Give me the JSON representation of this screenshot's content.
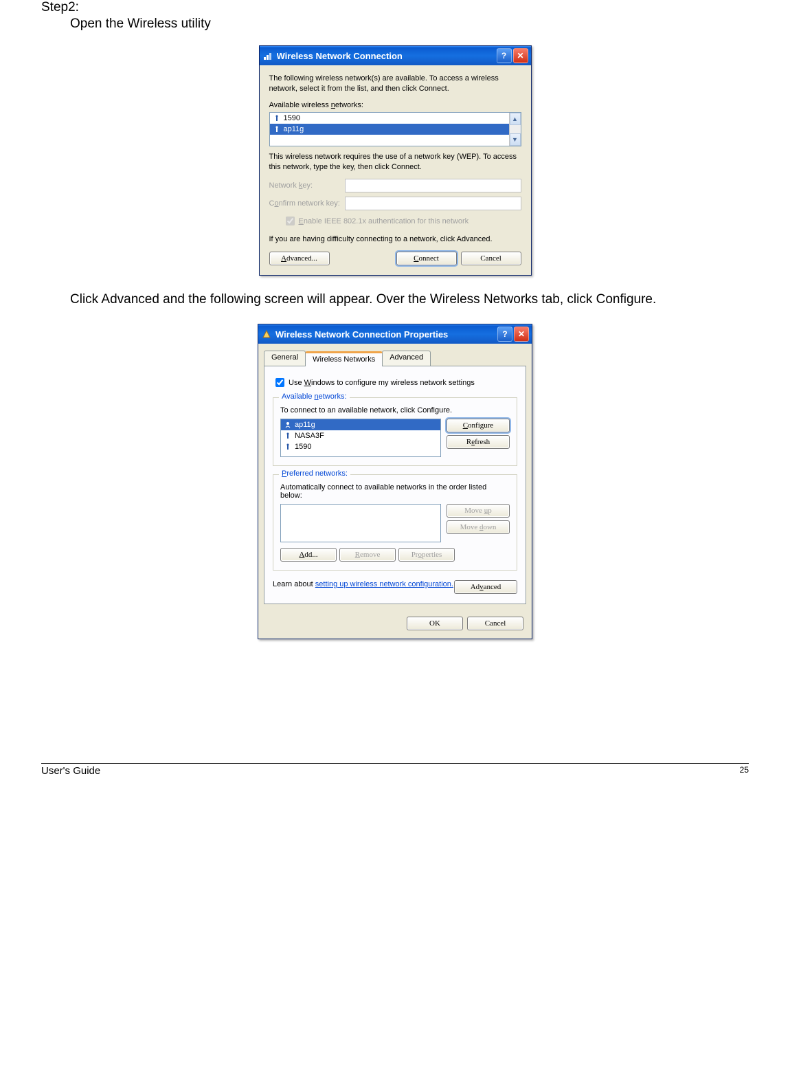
{
  "step": {
    "label": "Step2:",
    "text": "Open the Wireless utility"
  },
  "body_text": "Click Advanced and the following screen will appear. Over the Wireless Networks tab, click Configure.",
  "dialog1": {
    "title": "Wireless Network Connection",
    "intro": "The following wireless network(s) are available. To access a wireless network, select it from the list, and then click Connect.",
    "available_label": "Available wireless networks:",
    "networks": [
      {
        "name": "1590",
        "selected": false
      },
      {
        "name": "ap11g",
        "selected": true
      }
    ],
    "wep_text": "This wireless network requires the use of a network key (WEP). To access this network, type the key, then click Connect.",
    "key_label": "Network key:",
    "confirm_label": "Confirm network key:",
    "enable_8021x": "Enable IEEE 802.1x authentication for this network",
    "difficulty": "If you are having difficulty connecting to a network, click Advanced.",
    "btn_advanced": "Advanced...",
    "btn_connect": "Connect",
    "btn_cancel": "Cancel"
  },
  "dialog2": {
    "title": "Wireless Network Connection Properties",
    "tabs": {
      "general": "General",
      "wireless": "Wireless Networks",
      "advanced": "Advanced"
    },
    "use_windows": "Use Windows to configure my wireless network settings",
    "available": {
      "legend": "Available networks:",
      "text": "To connect to an available network, click Configure.",
      "items": [
        {
          "name": "ap11g",
          "selected": true,
          "icon": "preferred"
        },
        {
          "name": "NASA3F",
          "selected": false,
          "icon": "net"
        },
        {
          "name": "1590",
          "selected": false,
          "icon": "net"
        }
      ],
      "btn_configure": "Configure",
      "btn_refresh": "Refresh"
    },
    "preferred": {
      "legend": "Preferred networks:",
      "text": "Automatically connect to available networks in the order listed below:",
      "btn_up": "Move up",
      "btn_down": "Move down",
      "btn_add": "Add...",
      "btn_remove": "Remove",
      "btn_props": "Properties"
    },
    "learn_prefix": "Learn about ",
    "learn_link": "setting up wireless network configuration.",
    "btn_advanced": "Advanced",
    "btn_ok": "OK",
    "btn_cancel": "Cancel"
  },
  "footer": {
    "left": "User's Guide",
    "page": "25"
  }
}
